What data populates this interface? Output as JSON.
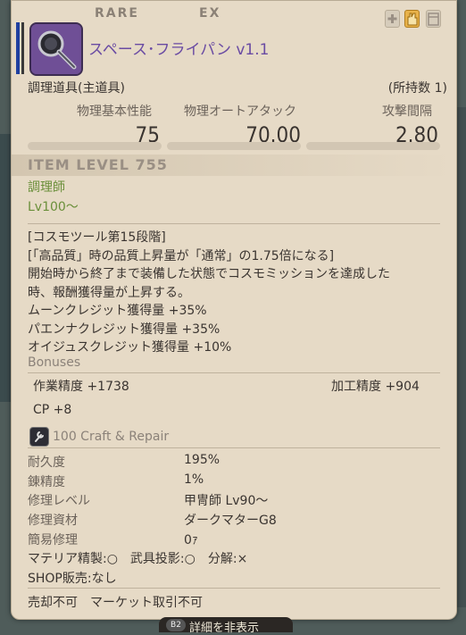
{
  "header": {
    "rarity_left": "RARE",
    "rarity_right": "EX",
    "item_name": "スペース･フライパン v1.1",
    "category": "調理道具(主道具)",
    "owned": "(所持数 1)"
  },
  "stats": [
    {
      "label": "物理基本性能",
      "value": "75"
    },
    {
      "label": "物理オートアタック",
      "value": "70.00"
    },
    {
      "label": "攻撃間隔",
      "value": "2.80"
    }
  ],
  "item_level": "ITEM LEVEL 755",
  "job": "調理師",
  "level": "Lv100～",
  "description": [
    "[コスモツール第15段階]",
    "[「高品質」時の品質上昇量が「通常」の1.75倍になる]",
    "開始時から終了まで装備した状態でコスモミッションを達成した",
    "時、報酬獲得量が上昇する。",
    "ムーンクレジット獲得量 +35%",
    "パエンナクレジット獲得量 +35%",
    "オイジュスクレジット獲得量 +10%"
  ],
  "bonuses": {
    "heading": "Bonuses",
    "craftsmanship": "作業精度 +1738",
    "control": "加工精度 +904",
    "cp": "CP +8"
  },
  "repair": {
    "heading": "100 Craft & Repair",
    "rows": [
      {
        "label": "耐久度",
        "value": "195%"
      },
      {
        "label": "錬精度",
        "value": "1%"
      },
      {
        "label": "修理レベル",
        "value": "甲冑師 Lv90～"
      },
      {
        "label": "修理資材",
        "value": "ダークマターG8"
      },
      {
        "label": "簡易修理",
        "value": "0ｧ"
      }
    ]
  },
  "materia_line": "マテリア精製:○　武具投影:○　分解:×",
  "shop_line": "SHOP販売:なし",
  "trade_line": "売却不可　マーケット取引不可",
  "footer": {
    "key": "B2",
    "label": "詳細を非表示"
  },
  "colors": {
    "item_name": "#6a4ba3",
    "job": "#6a8f3a",
    "panel": "#e6dac6"
  }
}
